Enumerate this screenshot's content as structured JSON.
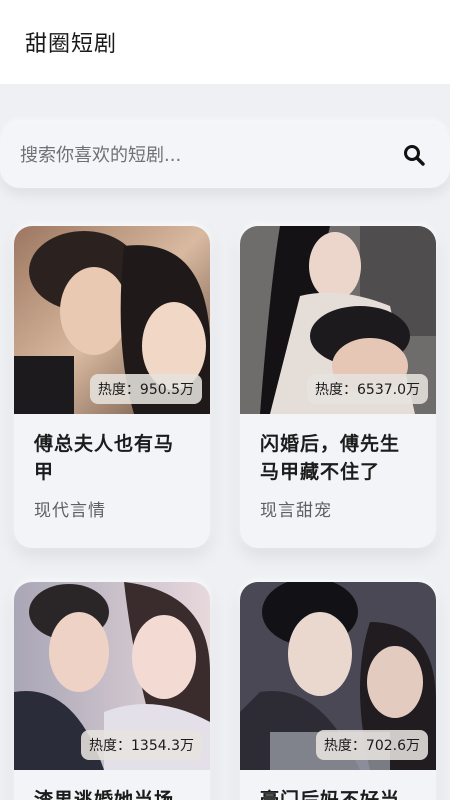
{
  "app": {
    "title": "甜圈短剧"
  },
  "search": {
    "placeholder": "搜索你喜欢的短剧..."
  },
  "heat_prefix": "热度：",
  "dramas": [
    {
      "title": "傅总夫人也有马甲",
      "genre": "现代言情",
      "heat": "950.5万",
      "palette": [
        "#7b5a44",
        "#e8c9b0",
        "#2d2421"
      ]
    },
    {
      "title": "闪婚后，傅先生马甲藏不住了",
      "genre": "现言甜宠",
      "heat": "6537.0万",
      "palette": [
        "#6d6b6a",
        "#ddd5cf",
        "#1e1c1d"
      ]
    },
    {
      "title": "渣男逃婚她当场",
      "genre": "",
      "heat": "1354.3万",
      "palette": [
        "#b8b4c2",
        "#f0d6d4",
        "#2a2930"
      ]
    },
    {
      "title": "豪门后妈不好当",
      "genre": "",
      "heat": "702.6万",
      "palette": [
        "#4a4a55",
        "#d9cfc9",
        "#151519"
      ]
    }
  ]
}
